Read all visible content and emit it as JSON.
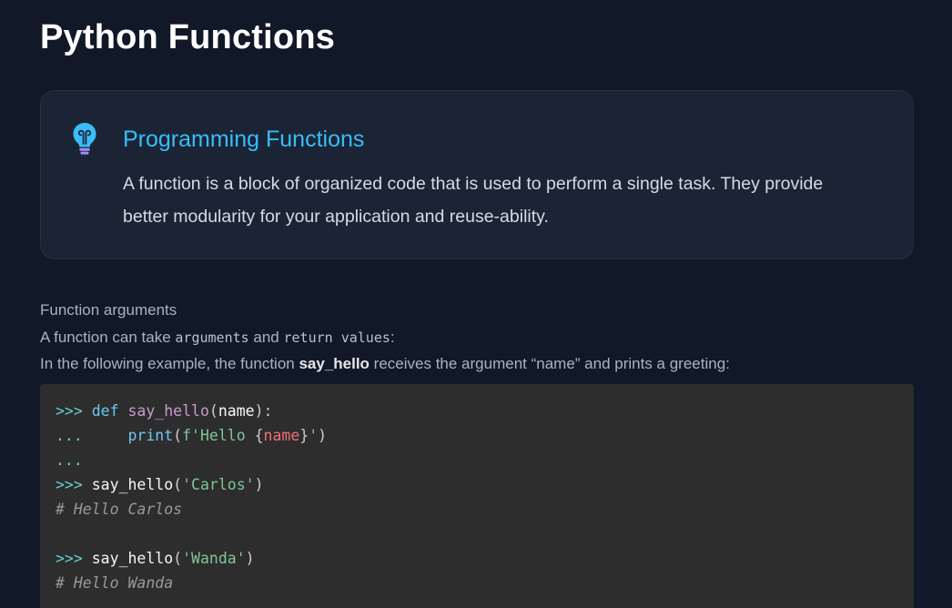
{
  "page": {
    "title": "Python Functions"
  },
  "callout": {
    "icon": "lightbulb-icon",
    "title": "Programming Functions",
    "body": "A function is a block of organized code that is used to perform a single task. They provide better modularity for your application and reuse-ability."
  },
  "section": {
    "heading": "Function arguments",
    "line2_prefix": "A function can take ",
    "line2_code1": "arguments",
    "line2_mid": " and ",
    "line2_code2": "return values",
    "line2_suffix": ":",
    "line3_prefix": "In the following example, the function ",
    "line3_bold": "say_hello",
    "line3_suffix": " receives the argument “name” and prints a greeting:"
  },
  "code": {
    "lines": [
      [
        {
          "t": ">>> ",
          "c": "prompt"
        },
        {
          "t": "def",
          "c": "kw"
        },
        {
          "t": " ",
          "c": "plain"
        },
        {
          "t": "say_hello",
          "c": "fn"
        },
        {
          "t": "(",
          "c": "punct"
        },
        {
          "t": "name",
          "c": "plain"
        },
        {
          "t": "):",
          "c": "punct"
        }
      ],
      [
        {
          "t": "...     ",
          "c": "prompt"
        },
        {
          "t": "print",
          "c": "builtin"
        },
        {
          "t": "(",
          "c": "punct"
        },
        {
          "t": "f'Hello ",
          "c": "str"
        },
        {
          "t": "{",
          "c": "punct"
        },
        {
          "t": "name",
          "c": "interp"
        },
        {
          "t": "}",
          "c": "punct"
        },
        {
          "t": "'",
          "c": "str"
        },
        {
          "t": ")",
          "c": "punct"
        }
      ],
      [
        {
          "t": "...",
          "c": "prompt"
        }
      ],
      [
        {
          "t": ">>> ",
          "c": "prompt"
        },
        {
          "t": "say_hello",
          "c": "plain"
        },
        {
          "t": "(",
          "c": "punct"
        },
        {
          "t": "'Carlos'",
          "c": "str"
        },
        {
          "t": ")",
          "c": "punct"
        }
      ],
      [
        {
          "t": "# Hello Carlos",
          "c": "comment"
        }
      ],
      [],
      [
        {
          "t": ">>> ",
          "c": "prompt"
        },
        {
          "t": "say_hello",
          "c": "plain"
        },
        {
          "t": "(",
          "c": "punct"
        },
        {
          "t": "'Wanda'",
          "c": "str"
        },
        {
          "t": ")",
          "c": "punct"
        }
      ],
      [
        {
          "t": "# Hello Wanda",
          "c": "comment"
        }
      ]
    ]
  },
  "colors": {
    "background": "#111827",
    "callout_background": "#1b2435",
    "accent": "#38bdf8",
    "code_background": "#2d2d2d"
  }
}
